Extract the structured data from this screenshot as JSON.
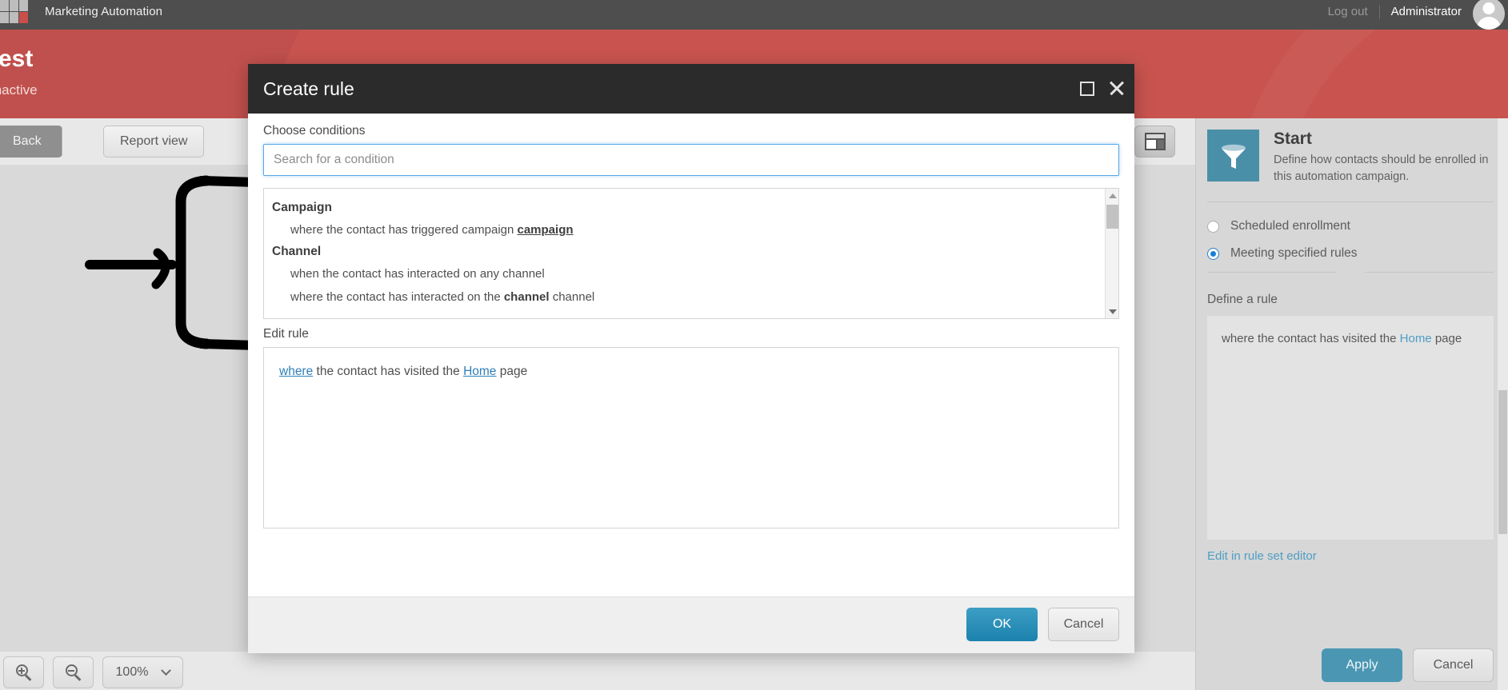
{
  "appbar": {
    "product_title": "Marketing Automation",
    "logout_label": "Log out",
    "user_name": "Administrator",
    "logo_icon": "waffle-grid-icon",
    "avatar_icon": "user-avatar-icon"
  },
  "hero": {
    "campaign_name": "test",
    "status": "Inactive"
  },
  "toolbar": {
    "back_label": "Back",
    "report_view_label": "Report view",
    "panel_toggle_icon": "layout-panel-icon"
  },
  "zoombar": {
    "zoom_in_icon": "zoom-in-icon",
    "zoom_out_icon": "zoom-out-icon",
    "zoom_level": "100%",
    "chevron_icon": "chevron-down-icon"
  },
  "sidebar": {
    "icon": "funnel-icon",
    "title": "Start",
    "description": "Define how contacts should be enrolled in this automation campaign.",
    "enrollment_options": [
      {
        "label": "Scheduled enrollment",
        "selected": false
      },
      {
        "label": "Meeting specified rules",
        "selected": true
      }
    ],
    "define_rule_label": "Define a rule",
    "rule_prefix": "where the contact has visited the ",
    "rule_link": "Home",
    "rule_suffix": " page",
    "edit_in_rule_set_editor": "Edit in rule set editor",
    "apply_label": "Apply",
    "cancel_label": "Cancel",
    "accent_color": "#4a8fa8",
    "link_color": "#4e9ec4"
  },
  "modal": {
    "title": "Create rule",
    "maximize_icon": "maximize-icon",
    "close_icon": "close-icon",
    "choose_conditions_label": "Choose conditions",
    "search": {
      "value": "",
      "placeholder": "Search for a condition"
    },
    "condition_groups": [
      {
        "name": "Campaign",
        "items": [
          {
            "prefix": "where the contact has triggered campaign ",
            "token": "campaign",
            "token_style": "underline",
            "suffix": ""
          }
        ]
      },
      {
        "name": "Channel",
        "items": [
          {
            "prefix": "when the contact has interacted on any channel",
            "token": "",
            "token_style": "",
            "suffix": ""
          },
          {
            "prefix": "where the contact has interacted on the ",
            "token": "channel",
            "token_style": "bold",
            "suffix": " channel"
          }
        ]
      }
    ],
    "scrollbar": {
      "up_icon": "scroll-up-arrow-icon",
      "down_icon": "scroll-down-arrow-icon"
    },
    "edit_rule_label": "Edit rule",
    "edit_rule": {
      "link1": "where",
      "middle": " the contact has visited the ",
      "link2": "Home",
      "suffix": " page"
    },
    "ok_label": "OK",
    "cancel_label": "Cancel",
    "header_color": "#2b2b2b",
    "ok_color": "#1b82ad"
  },
  "annotation": {
    "type": "hand-drawn-arrow-bracket",
    "color": "#000000"
  }
}
